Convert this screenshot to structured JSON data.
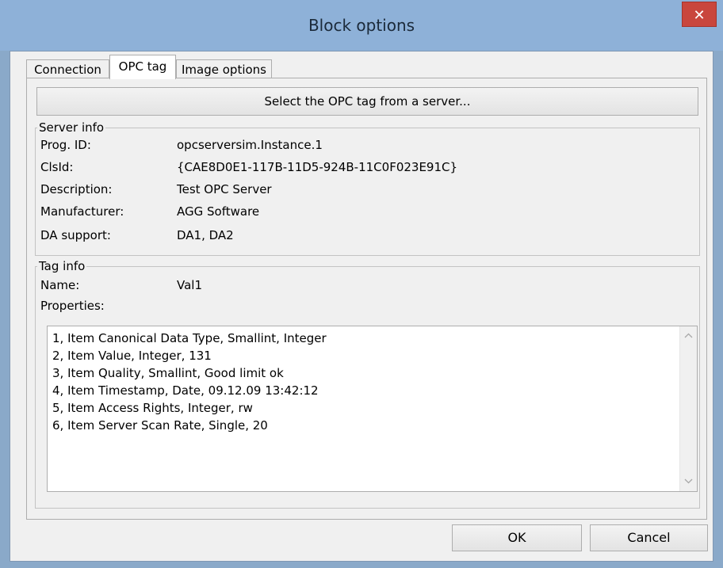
{
  "window": {
    "title": "Block options",
    "close_glyph": "✕"
  },
  "tabs": [
    {
      "label": "Connection"
    },
    {
      "label": "OPC tag"
    },
    {
      "label": "Image options"
    }
  ],
  "select_button": "Select the OPC tag from a server...",
  "server_info": {
    "title": "Server info",
    "rows": [
      {
        "label": "Prog. ID:",
        "value": "opcserversim.Instance.1"
      },
      {
        "label": "ClsId:",
        "value": "{CAE8D0E1-117B-11D5-924B-11C0F023E91C}"
      },
      {
        "label": "Description:",
        "value": "Test OPC Server"
      },
      {
        "label": "Manufacturer:",
        "value": "AGG Software"
      },
      {
        "label": "DA support:",
        "value": "DA1, DA2"
      }
    ]
  },
  "tag_info": {
    "title": "Tag info",
    "name_label": "Name:",
    "name_value": "Val1",
    "properties_label": "Properties:",
    "properties": [
      "1, Item Canonical Data Type, Smallint, Integer",
      "2, Item Value, Integer, 131",
      "3, Item Quality, Smallint, Good limit ok",
      "4, Item Timestamp, Date, 09.12.09 13:42:12",
      "5, Item Access Rights, Integer, rw",
      "6, Item Server Scan Rate, Single, 20"
    ]
  },
  "footer": {
    "ok_label": "OK",
    "cancel_label": "Cancel"
  },
  "icons": {
    "scroll_up": "chevron-up-icon",
    "scroll_down": "chevron-down-icon"
  }
}
